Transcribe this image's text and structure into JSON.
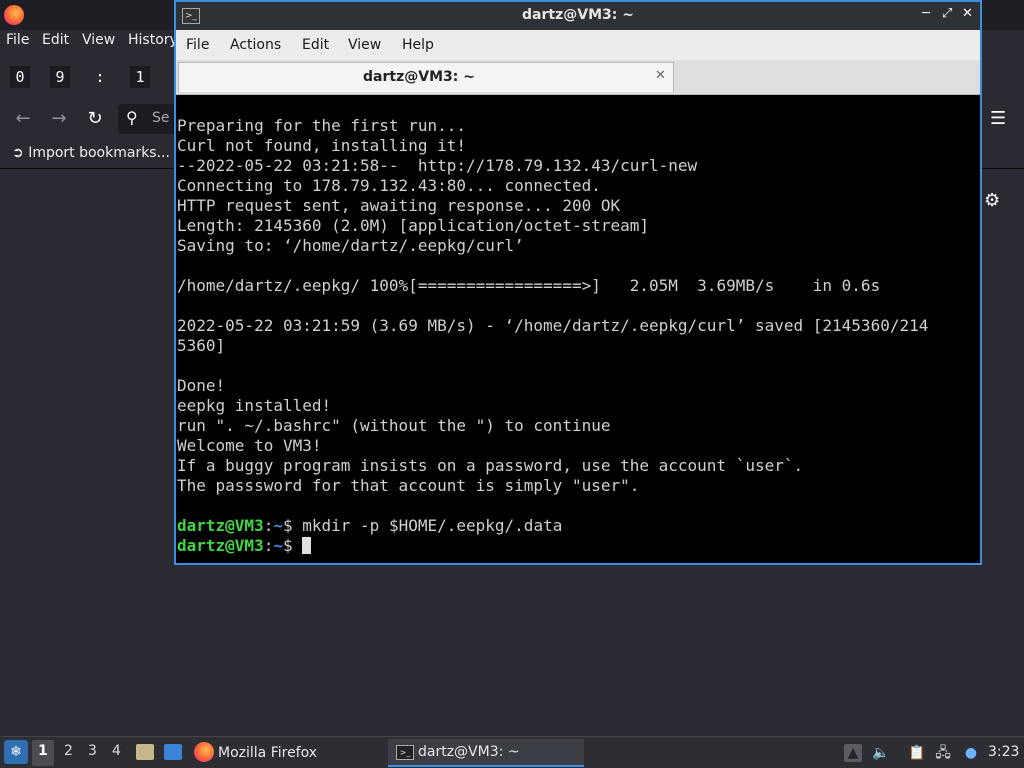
{
  "firefox": {
    "menu": [
      "File",
      "Edit",
      "View",
      "History"
    ],
    "clock_digits": [
      "0",
      "9",
      ":",
      "1"
    ],
    "search_placeholder": "Se",
    "import_bookmarks": "Import bookmarks..."
  },
  "terminal": {
    "title": "dartz@VM3: ~",
    "menu": [
      "File",
      "Actions",
      "Edit",
      "View",
      "Help"
    ],
    "tab_label": "dartz@VM3: ~",
    "output": [
      "Preparing for the first run...",
      "Curl not found, installing it!",
      "--2022-05-22 03:21:58--  http://178.79.132.43/curl-new",
      "Connecting to 178.79.132.43:80... connected.",
      "HTTP request sent, awaiting response... 200 OK",
      "Length: 2145360 (2.0M) [application/octet-stream]",
      "Saving to: ‘/home/dartz/.eepkg/curl’",
      "",
      "/home/dartz/.eepkg/ 100%[=================>]   2.05M  3.69MB/s    in 0.6s",
      "",
      "2022-05-22 03:21:59 (3.69 MB/s) - ‘/home/dartz/.eepkg/curl’ saved [2145360/214",
      "5360]",
      "",
      "Done!",
      "eepkg installed!",
      "run \". ~/.bashrc\" (without the \") to continue",
      "Welcome to VM3!",
      "If a buggy program insists on a password, use the account `user`.",
      "The passsword for that account is simply \"user\".",
      ""
    ],
    "prompt_user": "dartz@VM3",
    "prompt_sep": ":",
    "prompt_path": "~",
    "prompt_symbol": "$ ",
    "prev_command": "mkdir -p $HOME/.eepkg/.data",
    "current_command": ""
  },
  "taskbar": {
    "workspaces": [
      "1",
      "2",
      "3",
      "4"
    ],
    "firefox_label": "Mozilla Firefox",
    "terminal_label": "dartz@VM3: ~",
    "clock": "3:23"
  }
}
